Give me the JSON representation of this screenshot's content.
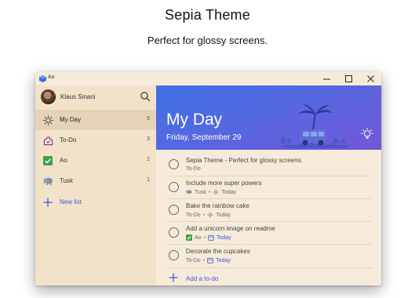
{
  "hero": {
    "title": "Sepia Theme",
    "subtitle": "Perfect for glossy screens."
  },
  "window": {
    "app_name": "Ao",
    "controls": [
      "minimize",
      "maximize",
      "close"
    ]
  },
  "sidebar": {
    "user_name": "Klaus Sinani",
    "items": [
      {
        "label": "My Day",
        "count": "5",
        "icon": "sun-icon",
        "active": true
      },
      {
        "label": "To-Do",
        "count": "3",
        "icon": "home-icon",
        "active": false
      },
      {
        "label": "Ao",
        "count": "1",
        "icon": "checkbox-icon",
        "active": false
      },
      {
        "label": "Tusk",
        "count": "1",
        "icon": "elephant-icon",
        "active": false
      }
    ],
    "new_list_label": "New list"
  },
  "main": {
    "banner_title": "My Day",
    "banner_date": "Friday, September 29",
    "tasks": [
      {
        "title": "Sepia Theme - Perfect for glossy screens.",
        "list": "To-Do",
        "list_icon": "",
        "today": ""
      },
      {
        "title": "Include more super powers",
        "list": "Tusk",
        "list_icon": "elephant-icon",
        "today": "Today",
        "today_icon": "sun-icon",
        "today_blue": false
      },
      {
        "title": "Bake the rainbow cake",
        "list": "To-Do",
        "list_icon": "",
        "today": "Today",
        "today_icon": "sun-icon",
        "today_blue": false
      },
      {
        "title": "Add a unicorn image on readme",
        "list": "Ao",
        "list_icon": "checkbox-icon",
        "today": "Today",
        "today_icon": "calendar-icon",
        "today_blue": true
      },
      {
        "title": "Decorate the cupcakes",
        "list": "To-Do",
        "list_icon": "",
        "today": "Today",
        "today_icon": "calendar-icon",
        "today_blue": true
      }
    ],
    "add_label": "Add a to-do"
  },
  "colors": {
    "accent": "#3b5bdb",
    "sepia_bg": "#f6ebda",
    "sidebar_bg": "#f2e2c9",
    "banner_start": "#3f6fe6",
    "banner_end": "#7455d8"
  }
}
